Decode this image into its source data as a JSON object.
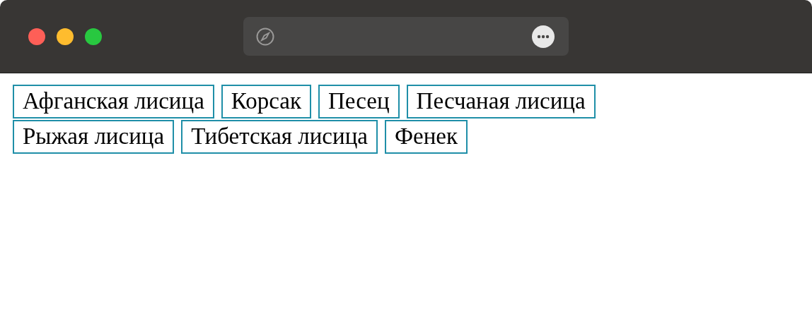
{
  "tags": [
    {
      "label": "Афганская лисица"
    },
    {
      "label": "Корсак"
    },
    {
      "label": "Песец"
    },
    {
      "label": "Песчаная лисица"
    },
    {
      "label": "Рыжая лисица"
    },
    {
      "label": "Тибетская лисица"
    },
    {
      "label": "Фенек"
    }
  ]
}
